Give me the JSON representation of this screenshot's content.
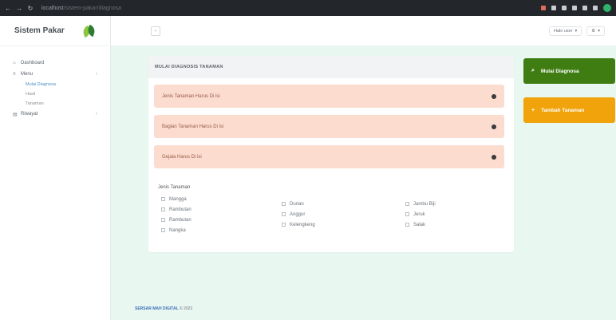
{
  "browser": {
    "url_host": "localhost",
    "url_path": "/sistem-pakar/diagnosa"
  },
  "sidebar": {
    "brand": "Sistem Pakar",
    "items": [
      {
        "label": "Dashboard",
        "icon": "home-icon"
      },
      {
        "label": "Menu",
        "icon": "list-icon"
      },
      {
        "label": "Riwayat",
        "icon": "clipboard-icon"
      }
    ],
    "submenu": [
      {
        "label": "Mulai Diagnosa",
        "active": true
      },
      {
        "label": "Hasil"
      },
      {
        "label": "Tanaman"
      }
    ]
  },
  "topbar": {
    "user_label": "Halo user",
    "settings_label": "⚙"
  },
  "card": {
    "title": "MULAI DIAGNOSIS TANAMAN",
    "alerts": [
      "Jenis Tanaman Harus Di isi",
      "Bagian Tanaman Harus Di isi",
      "Gejala Harus Di isi"
    ],
    "group_label": "Jenis Tanaman",
    "options_col1": [
      "Mangga",
      "Rambutan",
      "Rambutan",
      "Nangka"
    ],
    "options_col2": [
      "Durian",
      "Anggur",
      "Kelengkeng"
    ],
    "options_col3": [
      "Jambu Biji",
      "Jeruk",
      "Salak"
    ]
  },
  "actions": {
    "diagnose_label": "Mulai Diagnosa",
    "add_label": "Tambah Tanaman"
  },
  "footer": {
    "link": "SERSAR MAH DIGITAL",
    "text": "© 2022"
  },
  "colors": {
    "diagnose_button": "#3f7d12",
    "add_button": "#f0a30a",
    "alert_bg": "#fbdccf",
    "content_bg": "#e8f8f1"
  }
}
